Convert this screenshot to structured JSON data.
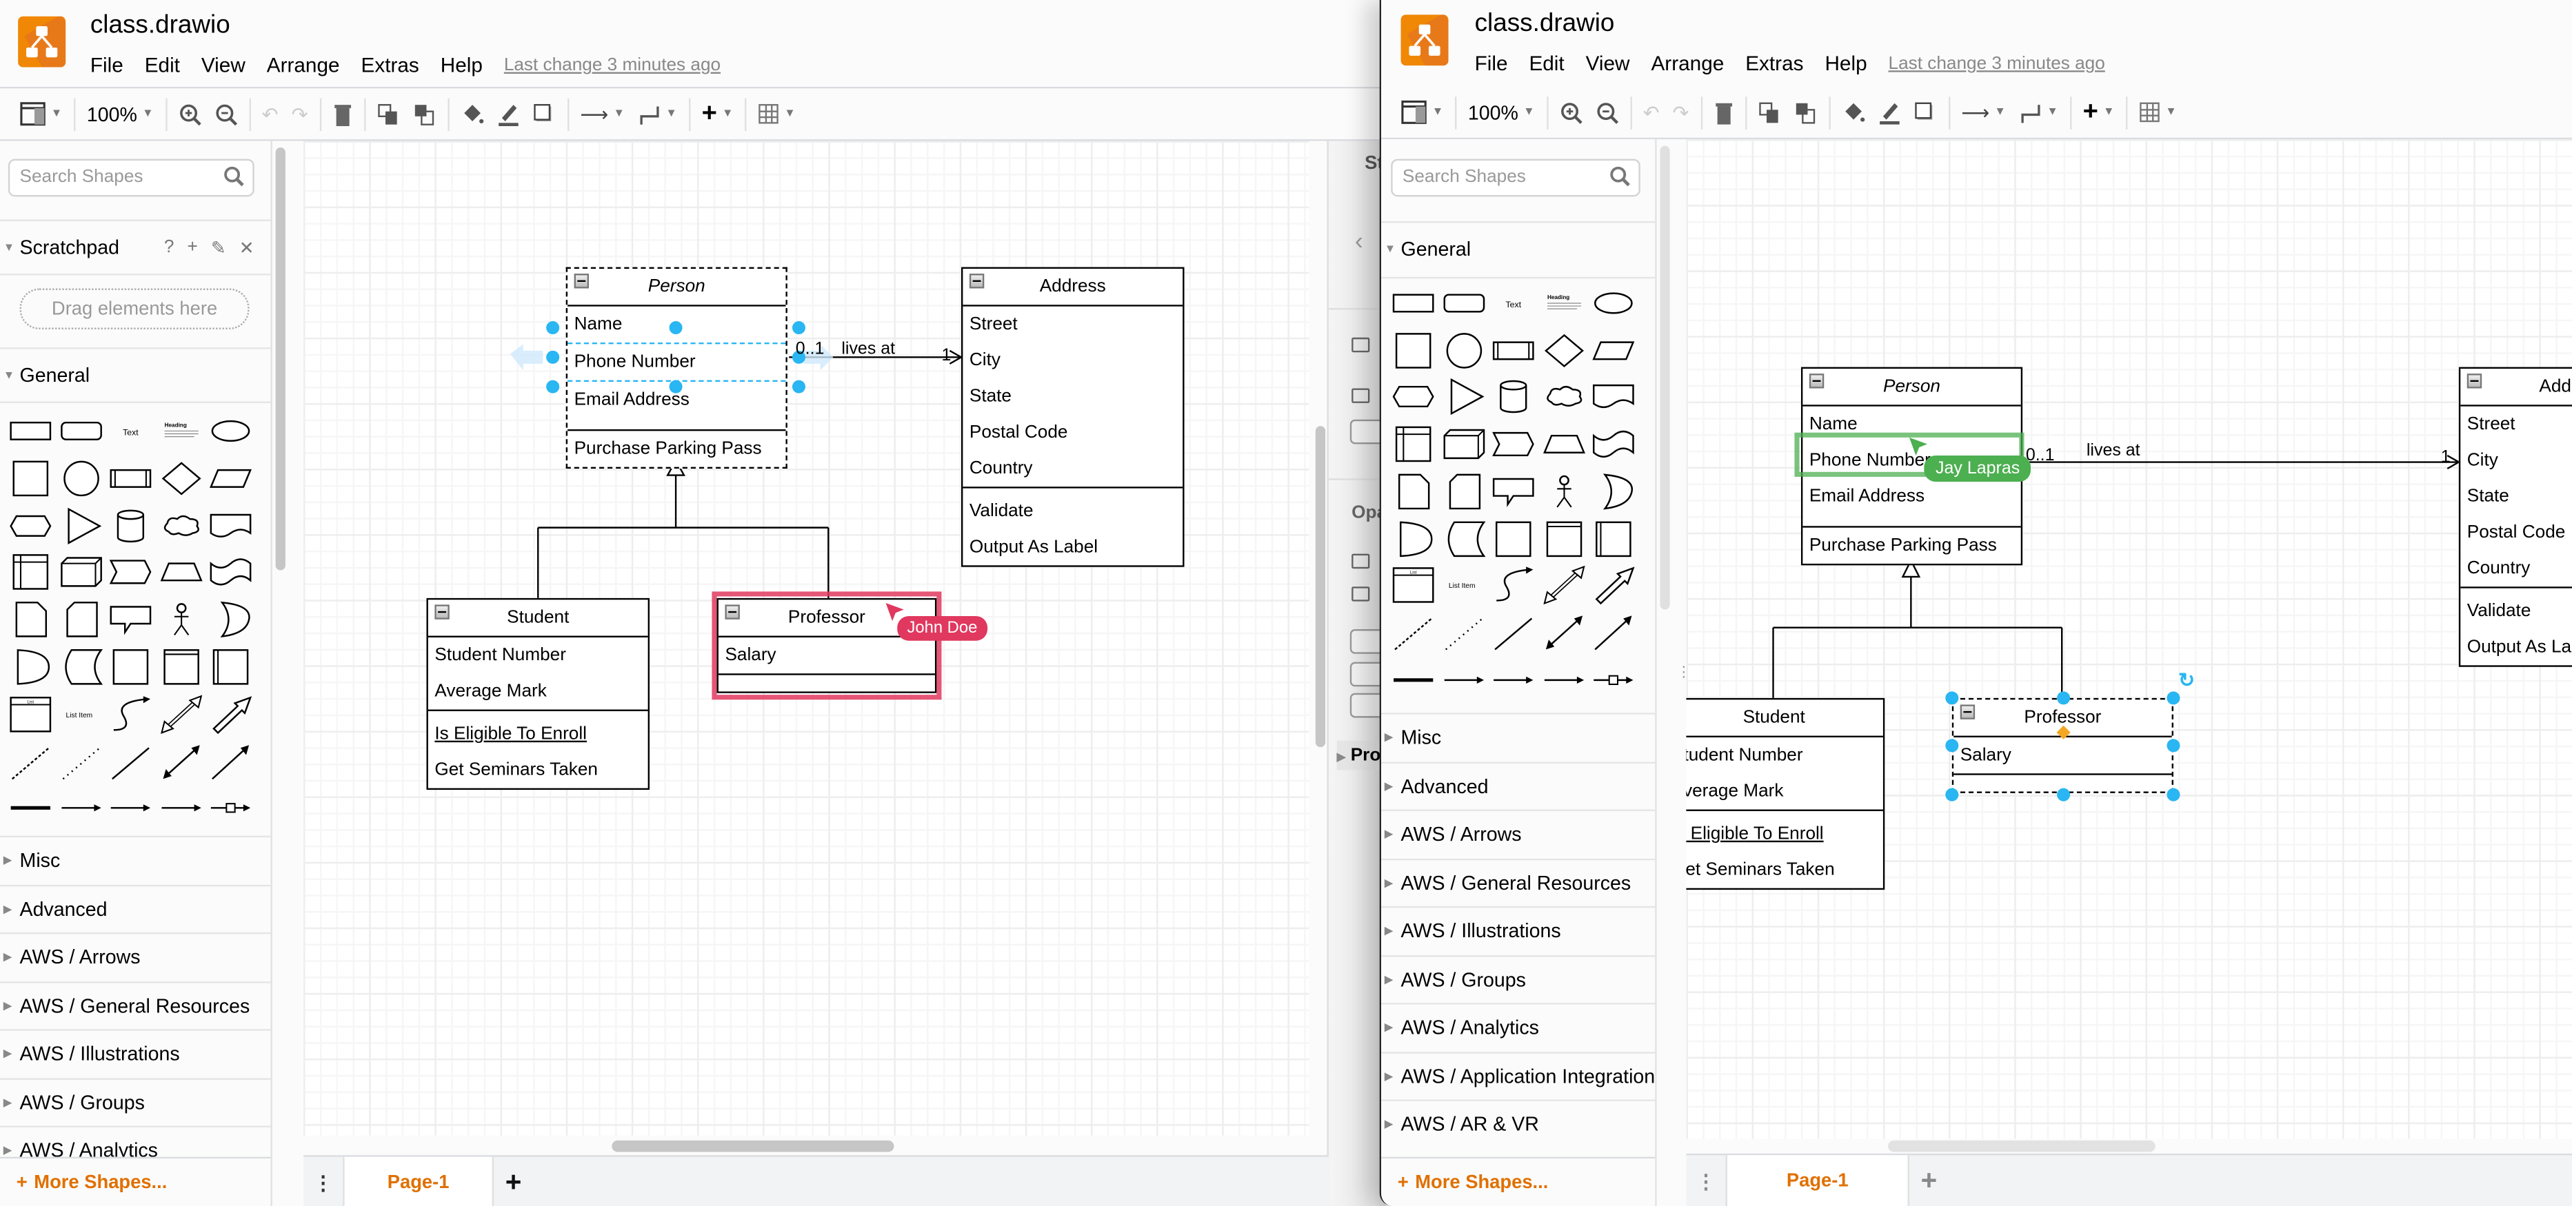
{
  "left_window": {
    "title": "class.drawio",
    "menus": [
      "File",
      "Edit",
      "View",
      "Arrange",
      "Extras",
      "Help"
    ],
    "last_change": "Last change 3 minutes ago",
    "toolbar": {
      "zoom": "100%"
    },
    "sidebar": {
      "search_placeholder": "Search Shapes",
      "scratchpad": {
        "label": "Scratchpad",
        "help": "?",
        "add": "+",
        "dropzone": "Drag elements here"
      },
      "general_label": "General",
      "shape_text": "Text",
      "shape_heading": "Heading",
      "shape_list_item": "List Item",
      "shape_list": "List",
      "sections": [
        "Misc",
        "Advanced",
        "AWS / Arrows",
        "AWS / General Resources",
        "AWS / Illustrations",
        "AWS / Groups",
        "AWS / Analytics"
      ],
      "more_shapes": "More Shapes..."
    },
    "format_panel": {
      "style_label": "St",
      "opacity_label": "Opa",
      "property_label": "Pro"
    },
    "diagram": {
      "person": {
        "name": "Person",
        "attributes": [
          "Name",
          "Phone Number",
          "Email Address"
        ],
        "operations": [
          "Purchase Parking Pass"
        ]
      },
      "address": {
        "name": "Address",
        "attributes": [
          "Street",
          "City",
          "State",
          "Postal Code",
          "Country"
        ],
        "operations": [
          "Validate",
          "Output As Label"
        ]
      },
      "student": {
        "name": "Student",
        "attributes": [
          "Student Number",
          "Average Mark"
        ],
        "operations": [
          "Is Eligible To Enroll",
          "Get Seminars Taken"
        ]
      },
      "professor": {
        "name": "Professor",
        "attributes": [
          "Salary"
        ],
        "operations": []
      },
      "association": {
        "label": "lives at",
        "source_multiplicity": "0..1",
        "target_multiplicity": "1"
      },
      "remote_cursor": {
        "user": "John Doe",
        "color": "#e0385f"
      }
    },
    "pages": {
      "tabs": [
        "Page-1"
      ],
      "active": "Page-1"
    }
  },
  "right_window": {
    "title": "class.drawio",
    "menus": [
      "File",
      "Edit",
      "View",
      "Arrange",
      "Extras",
      "Help"
    ],
    "last_change": "Last change 3 minutes ago",
    "toolbar": {
      "zoom": "100%"
    },
    "sidebar": {
      "search_placeholder": "Search Shapes",
      "general_label": "General",
      "sections": [
        "Misc",
        "Advanced",
        "AWS / Arrows",
        "AWS / General Resources",
        "AWS / Illustrations",
        "AWS / Groups",
        "AWS / Analytics",
        "AWS / Application Integration",
        "AWS / AR & VR"
      ],
      "more_shapes": "More Shapes..."
    },
    "diagram": {
      "person": {
        "name": "Person",
        "attributes": [
          "Name",
          "Phone Number",
          "Email Address"
        ],
        "operations": [
          "Purchase Parking Pass"
        ]
      },
      "address": {
        "name": "Address",
        "attributes": [
          "Street",
          "City",
          "State",
          "Postal Code",
          "Country"
        ],
        "operations": [
          "Validate",
          "Output As Label"
        ]
      },
      "student": {
        "name": "Student",
        "attributes": [
          "Student Number",
          "Average Mark"
        ],
        "operations": [
          "Is Eligible To Enroll",
          "Get Seminars Taken"
        ]
      },
      "professor": {
        "name": "Professor",
        "attributes": [
          "Salary"
        ],
        "operations": []
      },
      "association": {
        "label": "lives at",
        "source_multiplicity": "0..1",
        "target_multiplicity": "1"
      },
      "remote_cursor": {
        "user": "Jay Lapras",
        "color": "#4caf50"
      }
    },
    "pages": {
      "tabs": [
        "Page-1"
      ],
      "active": "Page-1"
    }
  },
  "colors": {
    "accent": "#e07000",
    "selection": "#29b6f2",
    "logo": "#f08705"
  }
}
